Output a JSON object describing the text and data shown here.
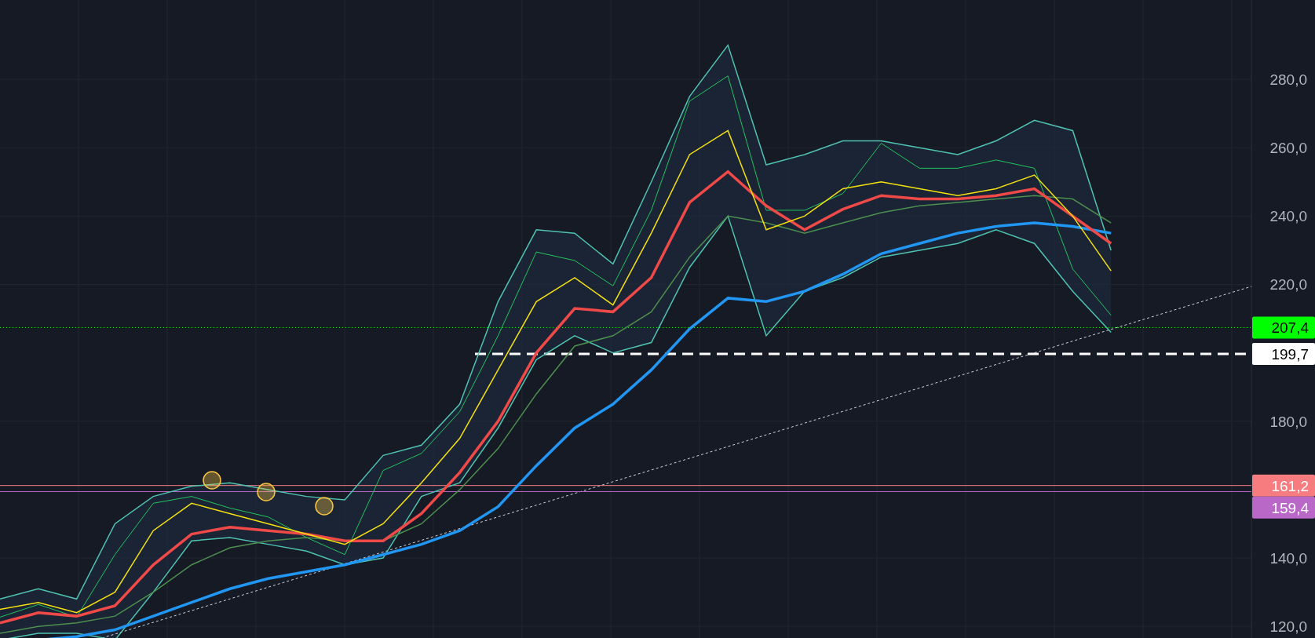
{
  "price_axis": {
    "labels": [
      "280,0",
      "260,0",
      "240,0",
      "220,0",
      "180,0",
      "140,0",
      "120,0"
    ]
  },
  "price_lines": [
    {
      "label": "207,4",
      "color": "#00ff00",
      "kind": "dotted"
    },
    {
      "label": "199,7",
      "color": "#ffffff",
      "kind": "dashed"
    },
    {
      "label": "161,2",
      "color": "#f77c80",
      "kind": "solid"
    },
    {
      "label": "159,4",
      "color": "#ba68c8",
      "kind": "solid"
    }
  ]
}
